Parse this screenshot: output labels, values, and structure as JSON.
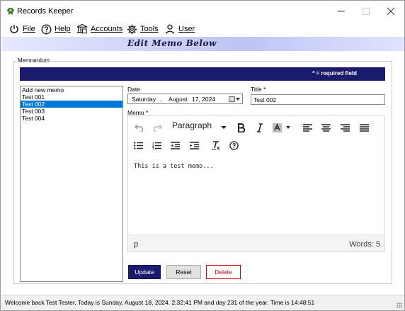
{
  "window": {
    "title": "Records Keeper",
    "controls": {
      "minimize": "—",
      "maximize": "",
      "close": "✕"
    }
  },
  "menu": {
    "items": [
      {
        "label": "File",
        "icon": "power-icon"
      },
      {
        "label": "Help",
        "icon": "help-circle-icon"
      },
      {
        "label": "Accounts",
        "icon": "bank-icon"
      },
      {
        "label": "Tools",
        "icon": "gear-icon"
      },
      {
        "label": "User",
        "icon": "user-icon"
      }
    ]
  },
  "banner": {
    "title": "Edit Memo Below"
  },
  "group": {
    "legend": "Memrandum"
  },
  "required": {
    "text": "* = required field"
  },
  "memo_list": {
    "items": [
      "Add new memo",
      "Test 001",
      "Test 002",
      "Test 003",
      "Test 004"
    ],
    "selected": "Test 002"
  },
  "date": {
    "label": "Date",
    "weekday": "Saturday",
    "sep": ",",
    "month": "August",
    "day_year": "17, 2024"
  },
  "title_field": {
    "label": "Title *",
    "value": "Test 002"
  },
  "memo": {
    "label": "Memo *",
    "format": "Paragraph",
    "body": "This is a test memo...",
    "path": "p",
    "words": "Words: 5"
  },
  "buttons": {
    "update": "Update",
    "reset": "Reset",
    "delete": "Delete"
  },
  "status": {
    "text": "Welcome back Test Tester.   Today is Sunday, August 18, 2024. 2:32:41 PM and day 231 of the year.   Time is 14:48:51"
  },
  "colors": {
    "accent": "#1b1b6e",
    "selection": "#0078d7",
    "delete": "#d40000",
    "banner_light": "#e6e9ff",
    "banner_dark": "#bec4f4"
  }
}
